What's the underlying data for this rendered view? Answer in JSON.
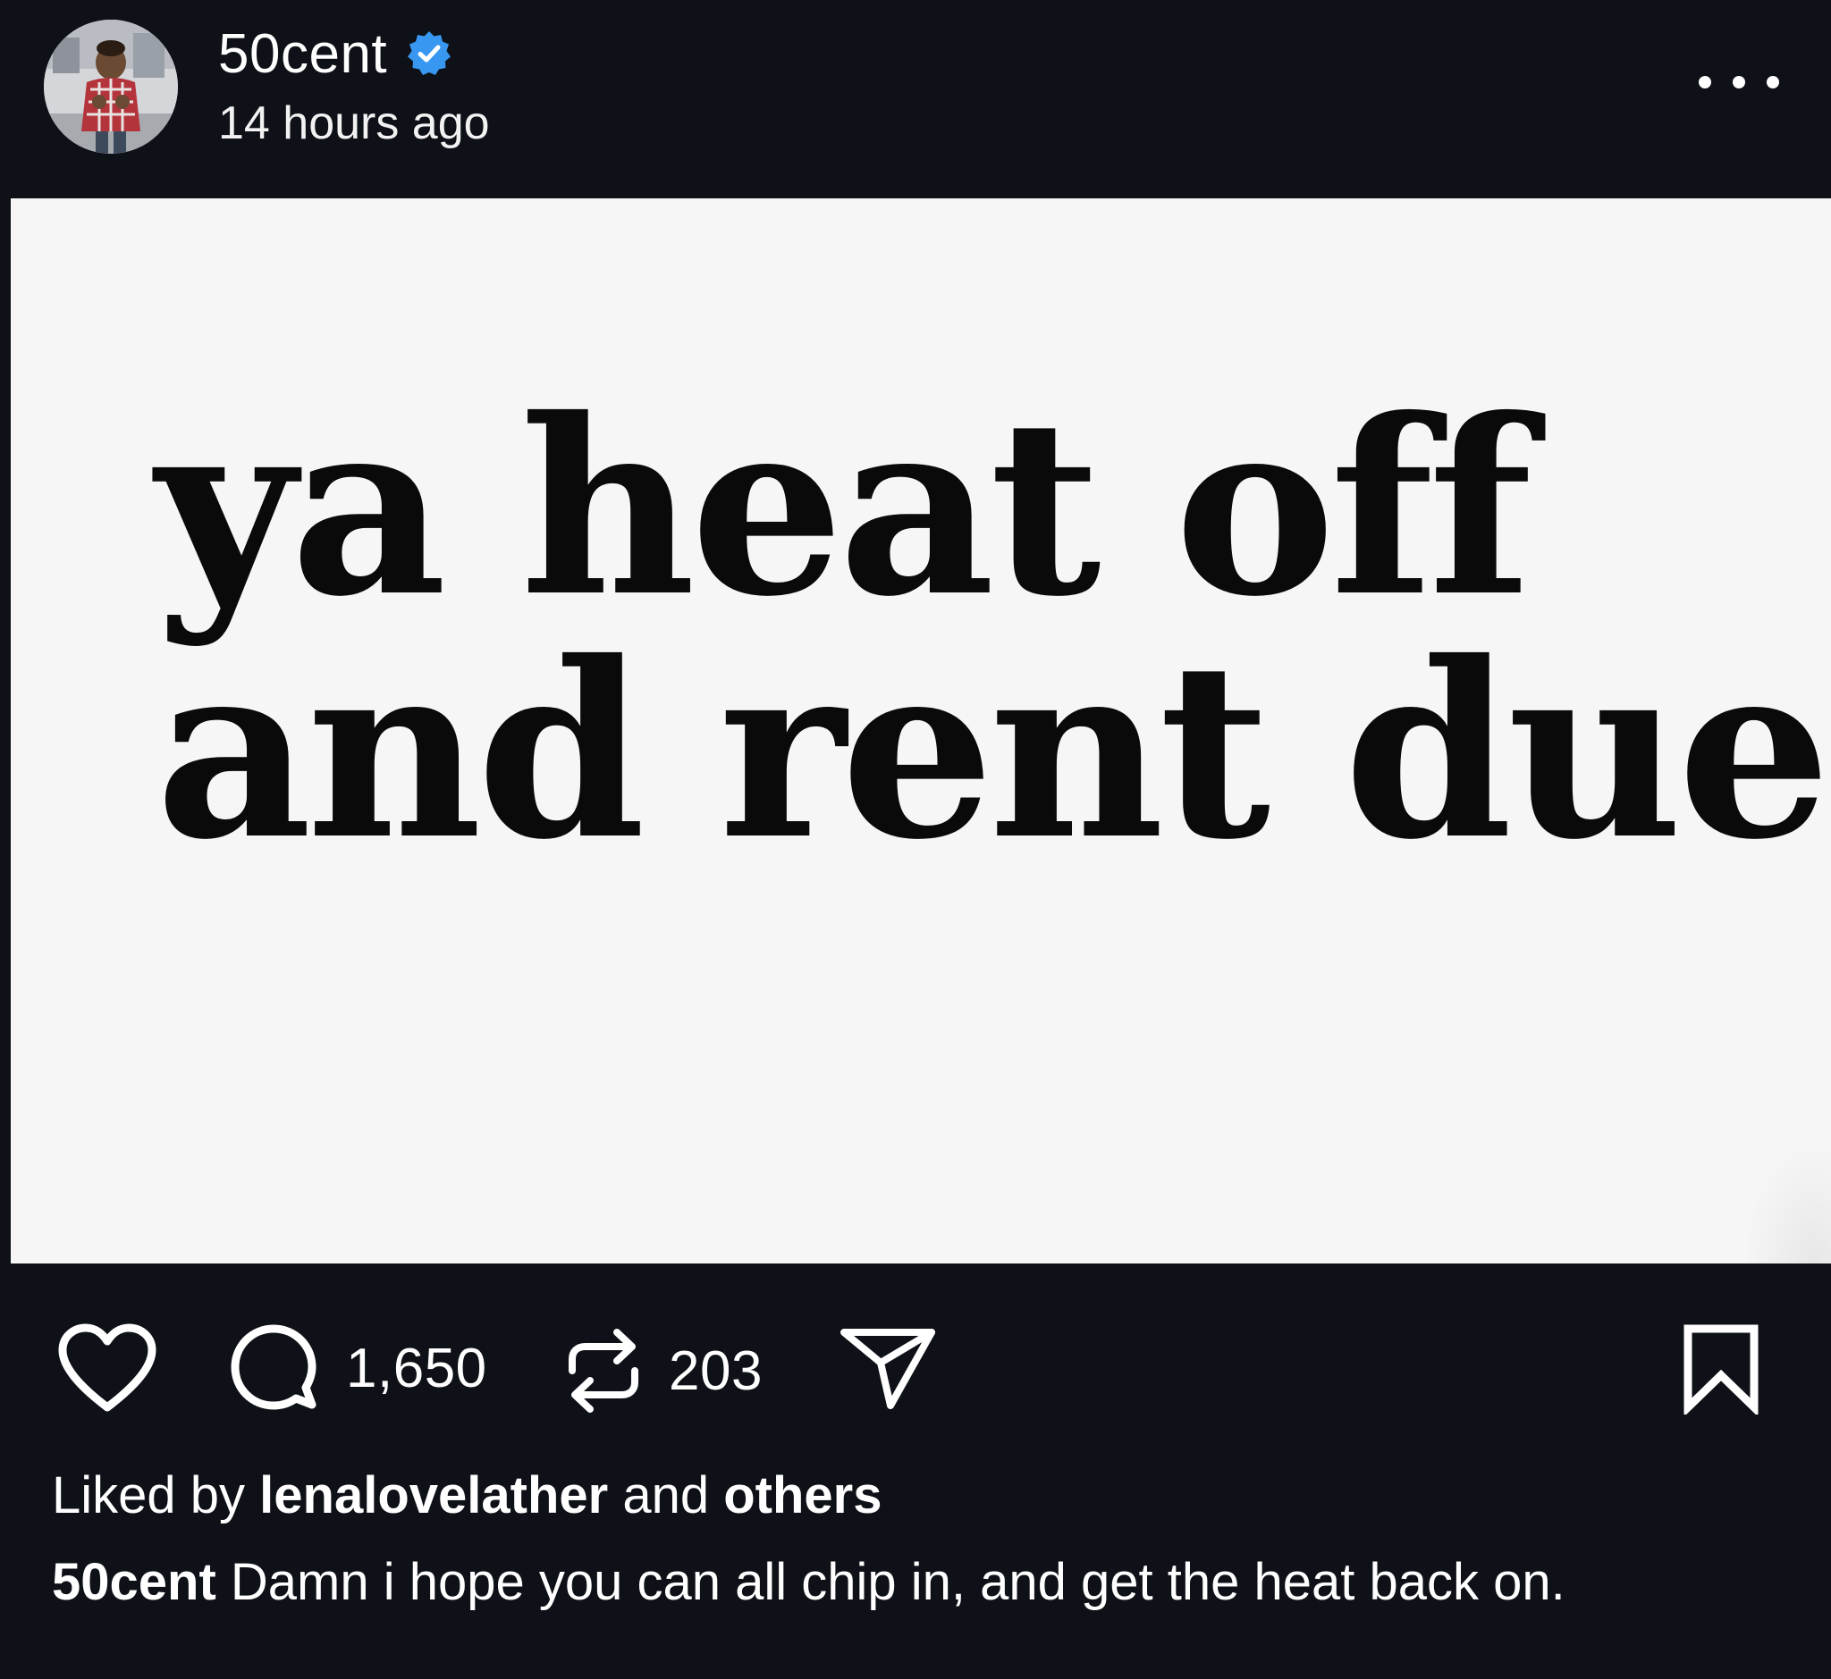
{
  "post": {
    "username": "50cent",
    "timestamp": "14 hours ago",
    "verified": true,
    "image_text": {
      "line1": "ya heat off",
      "line2": "and rent due"
    },
    "actions": {
      "comments_count": "1,650",
      "reposts_count": "203"
    },
    "liked_by": {
      "prefix": "Liked by",
      "user": "lenalovelather",
      "middle": "and",
      "suffix": "others"
    },
    "caption": {
      "author": "50cent",
      "text": "Damn i hope you can all chip in, and get the heat back on."
    }
  },
  "icons": {
    "more": "more-horizontal-icon",
    "verified": "verified-badge-icon",
    "like": "heart-icon",
    "comment": "comment-bubble-icon",
    "repost": "repost-arrows-icon",
    "share": "paper-plane-icon",
    "save": "bookmark-icon"
  },
  "colors": {
    "background": "#0e1117",
    "image_background": "#f6f6f6",
    "verified_blue": "#3897f0",
    "text": "#ffffff"
  }
}
